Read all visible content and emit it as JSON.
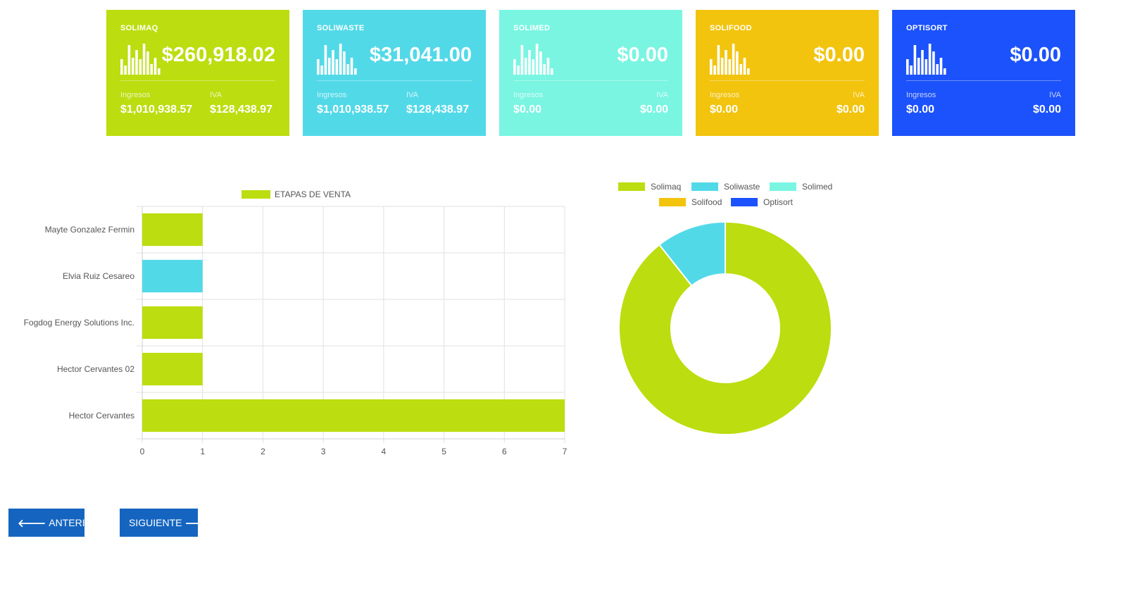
{
  "cards": [
    {
      "title": "SOLIMAQ",
      "value": "$260,918.02",
      "ingresos_label": "Ingresos",
      "ingresos": "$1,010,938.57",
      "iva_label": "IVA",
      "iva": "$128,438.97",
      "color": "#bcdd0f"
    },
    {
      "title": "SOLIWASTE",
      "value": "$31,041.00",
      "ingresos_label": "Ingresos",
      "ingresos": "$1,010,938.57",
      "iva_label": "IVA",
      "iva": "$128,438.97",
      "color": "#52d9e8"
    },
    {
      "title": "SOLIMED",
      "value": "$0.00",
      "ingresos_label": "Ingresos",
      "ingresos": "$0.00",
      "iva_label": "IVA",
      "iva": "$0.00",
      "color": "#79f5e2"
    },
    {
      "title": "SOLIFOOD",
      "value": "$0.00",
      "ingresos_label": "Ingresos",
      "ingresos": "$0.00",
      "iva_label": "IVA",
      "iva": "$0.00",
      "color": "#f2c40e"
    },
    {
      "title": "OPTISORT",
      "value": "$0.00",
      "ingresos_label": "Ingresos",
      "ingresos": "$0.00",
      "iva_label": "IVA",
      "iva": "$0.00",
      "color": "#1c52fb"
    }
  ],
  "card_icon": "bar-chart-icon",
  "chart_data": [
    {
      "type": "bar",
      "orientation": "horizontal",
      "categories": [
        "Mayte Gonzalez Fermin",
        "Elvia Ruiz Cesareo",
        "Fogdog Energy Solutions Inc.",
        "Hector Cervantes 02",
        "Hector Cervantes"
      ],
      "series": [
        {
          "name": "ETAPAS DE VENTA",
          "values": [
            1,
            1,
            1,
            1,
            7
          ]
        }
      ],
      "bar_colors": [
        "#bcdd0f",
        "#52d9e8",
        "#bcdd0f",
        "#bcdd0f",
        "#bcdd0f"
      ],
      "legend_color": "#bcdd0f",
      "xlim": [
        0,
        7
      ],
      "xticks": [
        "0",
        "1",
        "2",
        "3",
        "4",
        "5",
        "6",
        "7"
      ],
      "grid": true,
      "legend_position": "top"
    },
    {
      "type": "pie",
      "variant": "doughnut",
      "labels": [
        "Solimaq",
        "Soliwaste",
        "Solimed",
        "Solifood",
        "Optisort"
      ],
      "values": [
        260918.02,
        31041.0,
        0,
        0,
        0
      ],
      "colors": [
        "#bcdd0f",
        "#52d9e8",
        "#79f5e2",
        "#f2c40e",
        "#1c52fb"
      ],
      "legend_position": "top"
    }
  ],
  "nav": {
    "prev_label": "ANTERIOR",
    "next_label": "SIGUIENTE",
    "prev_icon": "arrow-left-icon",
    "next_icon": "arrow-right-icon"
  }
}
